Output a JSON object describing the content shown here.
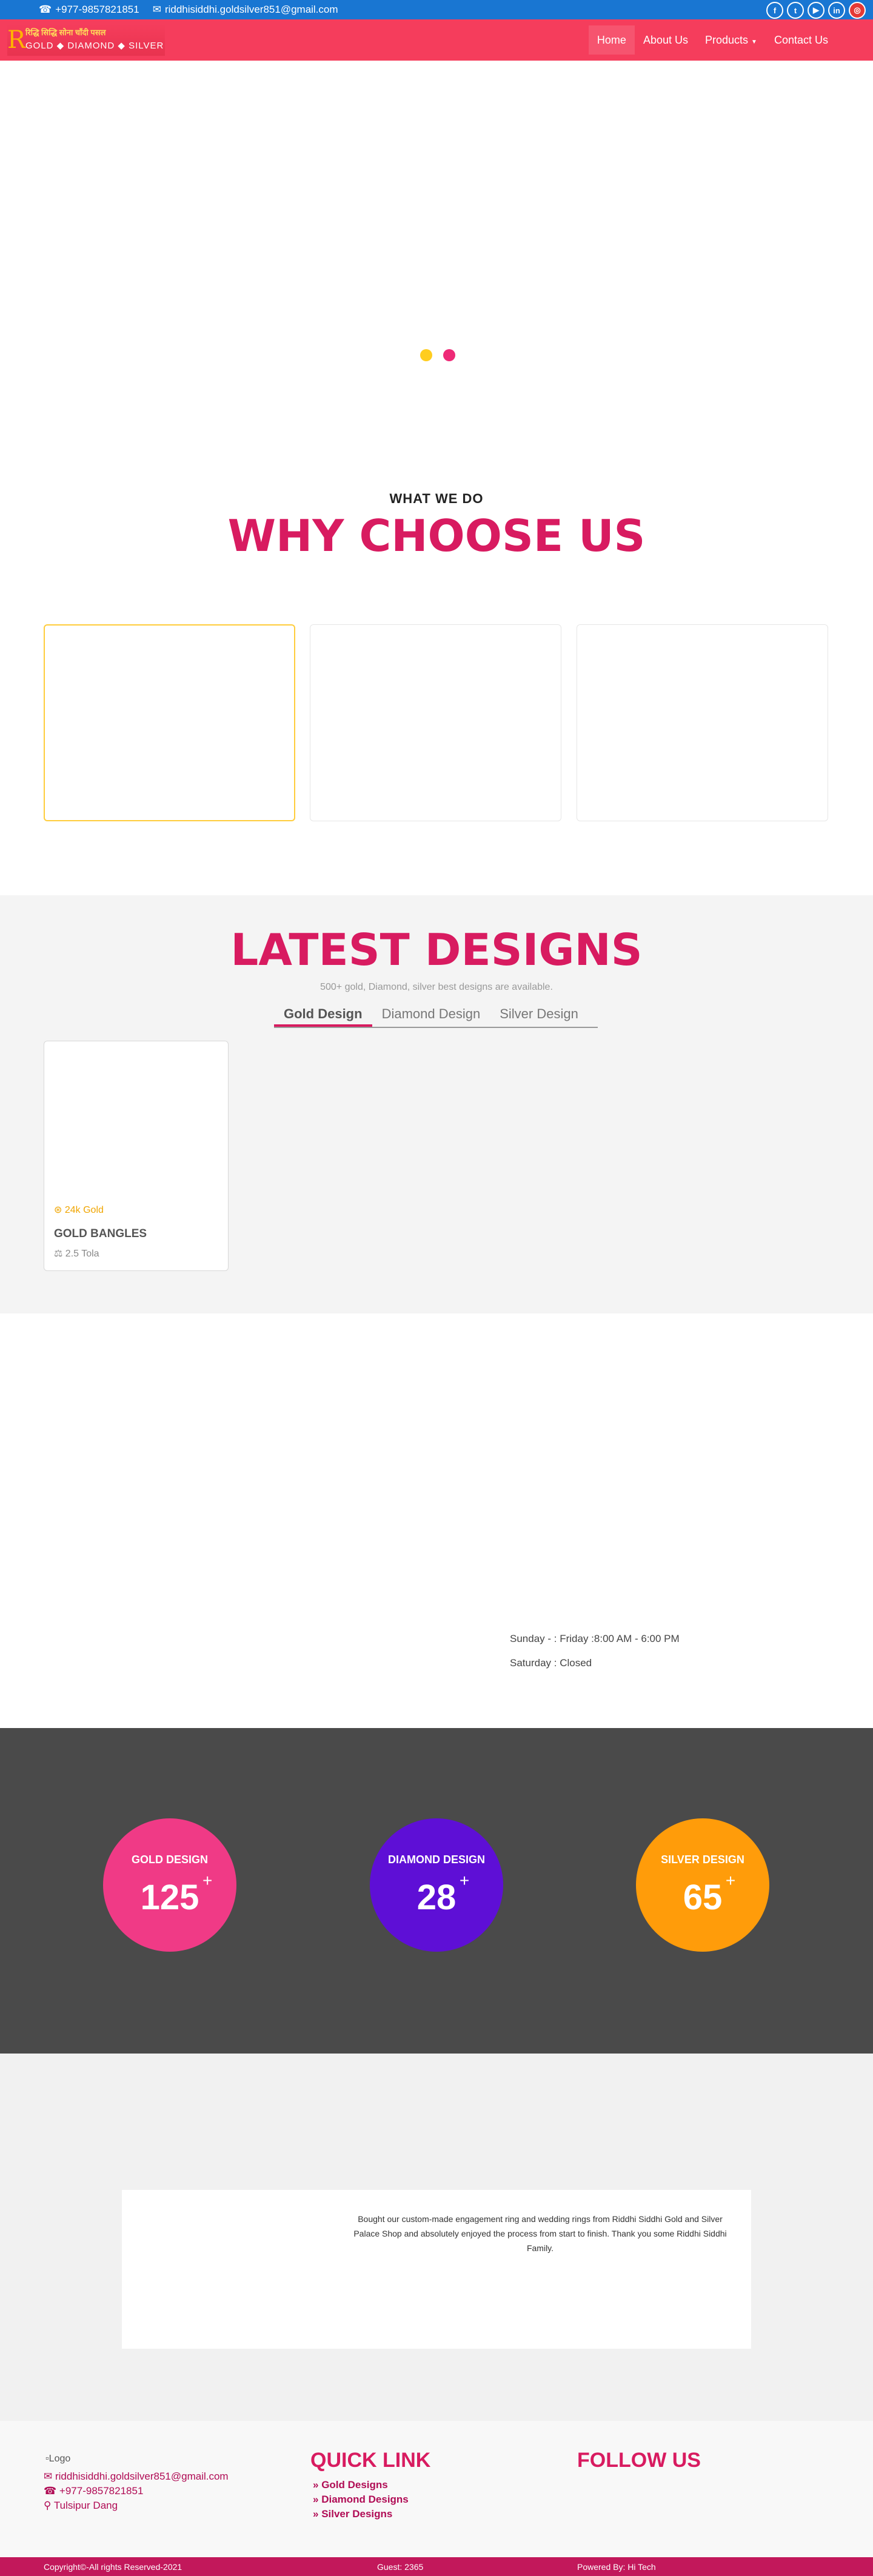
{
  "topbar": {
    "phone": "+977-9857821851",
    "email": "riddhisiddhi.goldsilver851@gmail.com",
    "social": [
      {
        "icon": "facebook-icon",
        "glyph": "f"
      },
      {
        "icon": "twitter-icon",
        "glyph": "t"
      },
      {
        "icon": "youtube-icon",
        "glyph": "▶"
      },
      {
        "icon": "linkedin-icon",
        "glyph": "in"
      },
      {
        "icon": "instagram-icon",
        "glyph": "◎"
      }
    ]
  },
  "brand": {
    "line1": "रिद्धि सिद्धि सोना चाँदी पसल",
    "line2": "GOLD ◆ DIAMOND ◆ SILVER"
  },
  "nav": {
    "items": [
      "Home",
      "About Us",
      "Products",
      "Contact Us"
    ],
    "active": "Home"
  },
  "colors": {
    "accent": "#d81b60",
    "topbar": "#1976d2",
    "navbar": "#f53d5c",
    "gold": "#ffcd3c"
  },
  "why": {
    "eyebrow": "WHAT WE DO",
    "title": "WHY CHOOSE US"
  },
  "latest": {
    "title": "LATEST DESIGNS",
    "subtitle": "500+ gold, Diamond, silver best designs are available.",
    "tabs": [
      "Gold Design",
      "Diamond Design",
      "Silver Design"
    ],
    "active_tab": "Gold Design",
    "products": [
      {
        "badge": "24k Gold",
        "name": "GOLD BANGLES",
        "weight": "2.5 Tola"
      }
    ]
  },
  "hours": {
    "weekdays": "Sunday - : Friday :8:00 AM - 6:00 PM",
    "saturday": "Saturday : Closed"
  },
  "counters": [
    {
      "label": "GOLD DESIGN",
      "value": "125",
      "color": "#f03a86"
    },
    {
      "label": "DIAMOND DESIGN",
      "value": "28",
      "color": "#5e0fd6"
    },
    {
      "label": "SILVER DESIGN",
      "value": "65",
      "color": "#ff9c0a"
    }
  ],
  "testimonial": {
    "quote": "Bought our custom-made engagement ring and wedding rings from Riddhi Siddhi Gold and Silver Palace Shop and absolutely enjoyed the process from start to finish. Thank you some Riddhi Siddhi Family."
  },
  "footer": {
    "logo_alt": "Logo",
    "email": "riddhisiddhi.goldsilver851@gmail.com",
    "phone": "+977-9857821851",
    "address": "Tulsipur Dang",
    "quick_link_title": "QUICK LINK",
    "quick_links": [
      "Gold Designs",
      "Diamond Designs",
      "Silver Designs"
    ],
    "follow_title": "FOLLOW US",
    "copyright": "Copyright©-All rights Reserved-2021",
    "guest": "Guest: 2365",
    "powered": "Powered By: Hi Tech"
  }
}
